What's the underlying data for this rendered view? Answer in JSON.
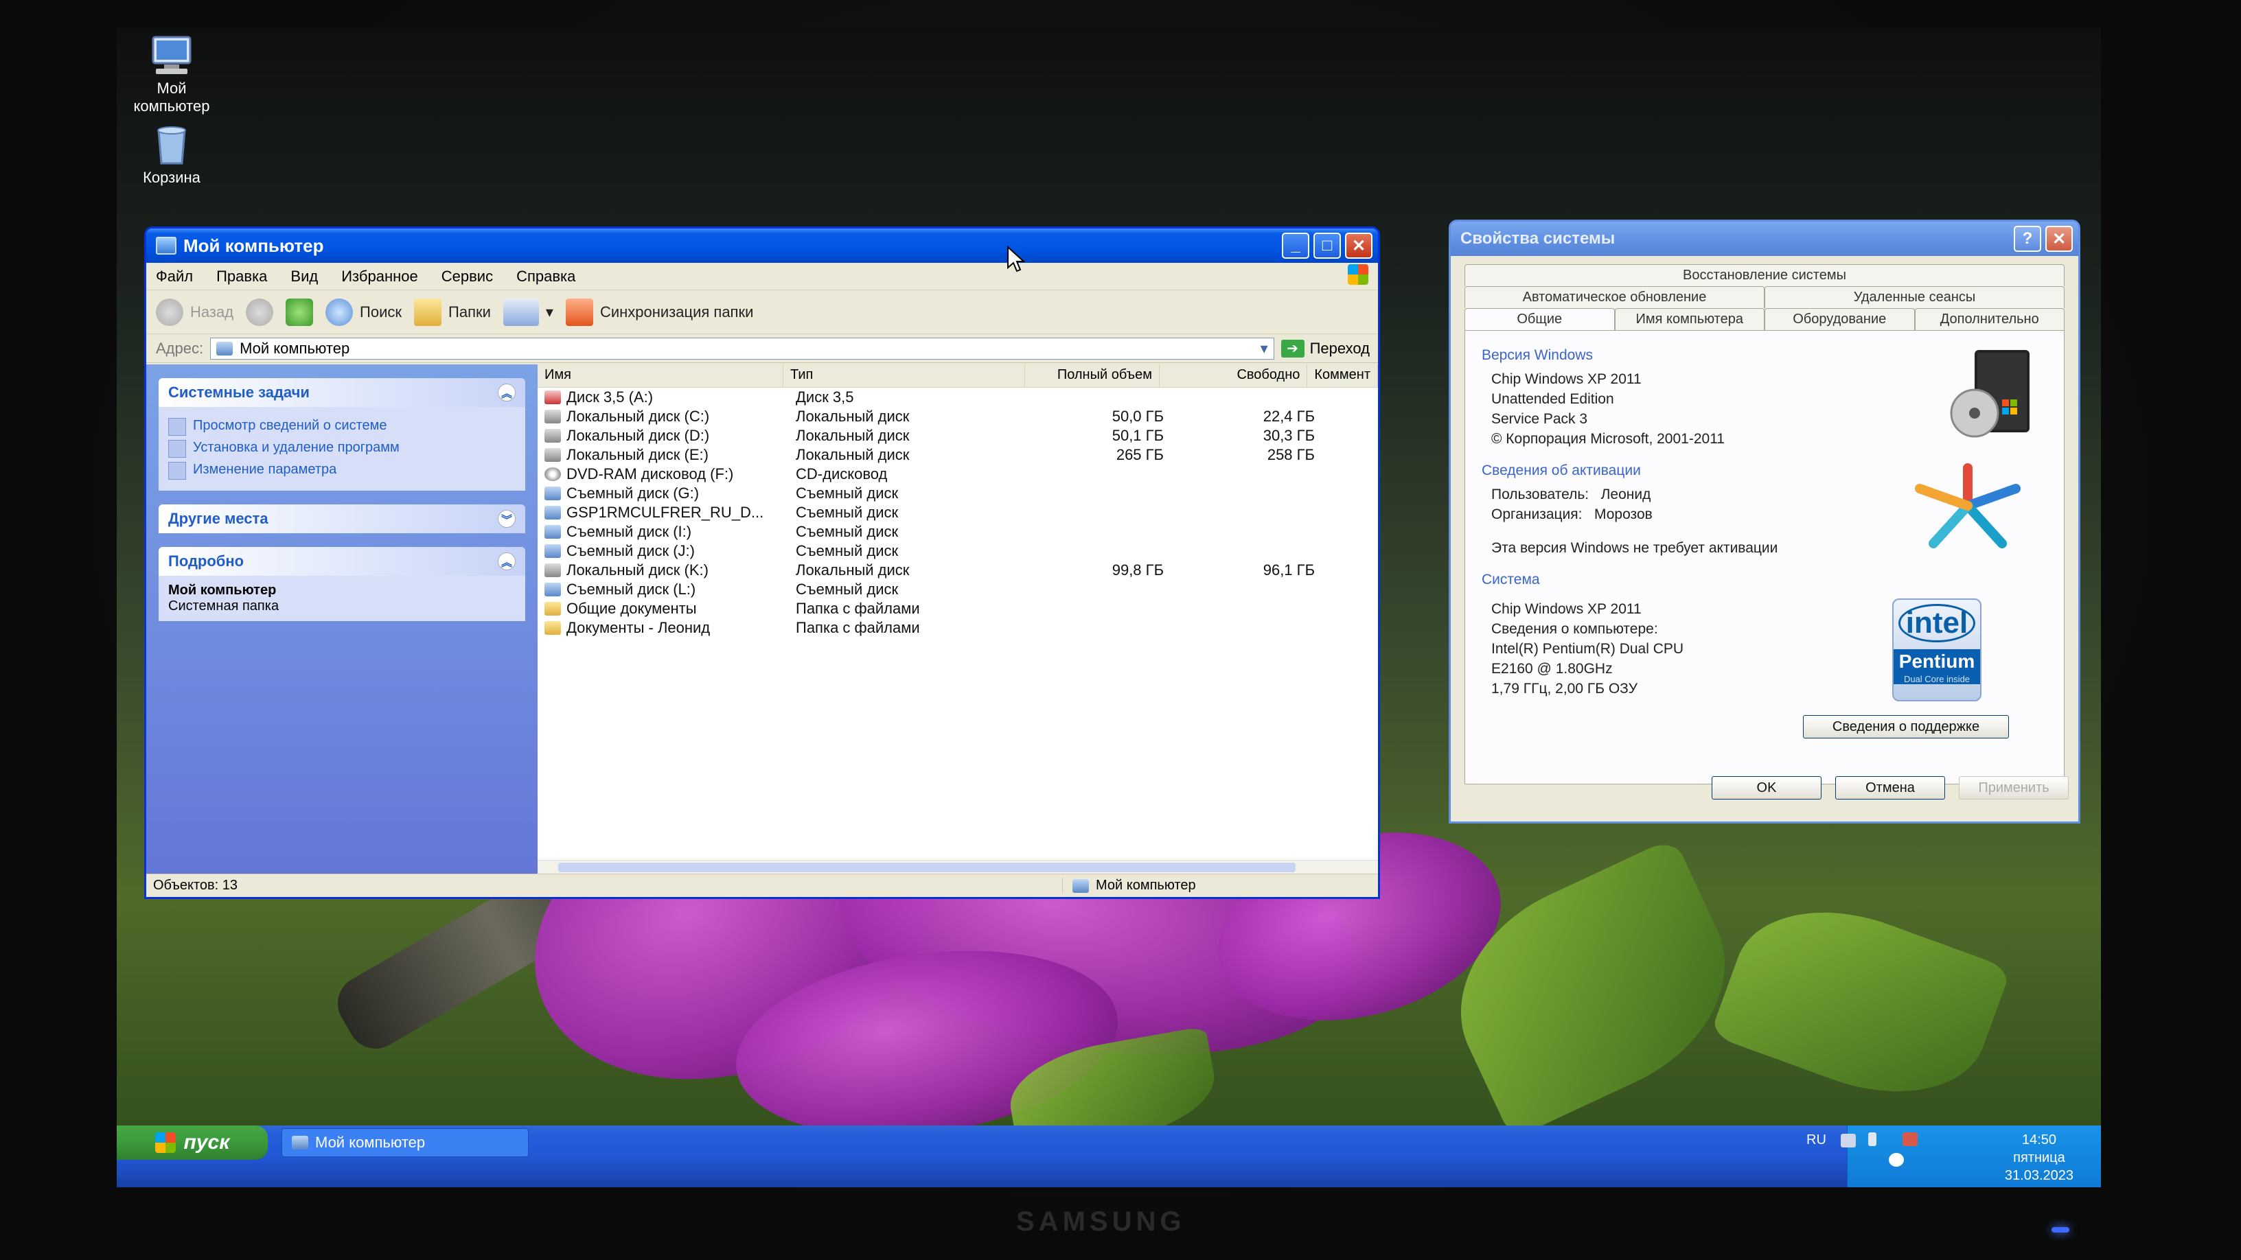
{
  "desktop": {
    "icons": [
      {
        "label_line1": "Мой",
        "label_line2": "компьютер",
        "icon": "my-computer-icon"
      },
      {
        "label_line1": "Корзина",
        "label_line2": "",
        "icon": "recycle-bin-icon"
      }
    ]
  },
  "explorer": {
    "title": "Мой компьютер",
    "menu": [
      "Файл",
      "Правка",
      "Вид",
      "Избранное",
      "Сервис",
      "Справка"
    ],
    "toolbar": {
      "back": "Назад",
      "search": "Поиск",
      "folders": "Папки",
      "sync": "Синхронизация папки"
    },
    "address": {
      "label": "Адрес:",
      "value": "Мой компьютер",
      "go": "Переход"
    },
    "side": {
      "system_tasks": {
        "title": "Системные задачи",
        "items": [
          "Просмотр сведений о системе",
          "Установка и удаление программ",
          "Изменение параметра"
        ]
      },
      "other_places": {
        "title": "Другие места"
      },
      "details": {
        "title": "Подробно",
        "name": "Мой компьютер",
        "desc": "Системная папка"
      }
    },
    "columns": [
      "Имя",
      "Тип",
      "Полный объем",
      "Свободно",
      "Коммент"
    ],
    "rows": [
      {
        "name": "Диск 3,5 (A:)",
        "type": "Диск 3,5",
        "total": "",
        "free": "",
        "icon": "fl"
      },
      {
        "name": "Локальный диск (C:)",
        "type": "Локальный диск",
        "total": "50,0 ГБ",
        "free": "22,4 ГБ",
        "icon": "hd"
      },
      {
        "name": "Локальный диск (D:)",
        "type": "Локальный диск",
        "total": "50,1 ГБ",
        "free": "30,3 ГБ",
        "icon": "hd"
      },
      {
        "name": "Локальный диск (E:)",
        "type": "Локальный диск",
        "total": "265 ГБ",
        "free": "258 ГБ",
        "icon": "hd"
      },
      {
        "name": "DVD-RAM дисковод (F:)",
        "type": "CD-дисковод",
        "total": "",
        "free": "",
        "icon": "cd"
      },
      {
        "name": "Съемный диск (G:)",
        "type": "Съемный диск",
        "total": "",
        "free": "",
        "icon": "rm"
      },
      {
        "name": "GSP1RMCULFRER_RU_D...",
        "type": "Съемный диск",
        "total": "",
        "free": "",
        "icon": "rm"
      },
      {
        "name": "Съемный диск (I:)",
        "type": "Съемный диск",
        "total": "",
        "free": "",
        "icon": "rm"
      },
      {
        "name": "Съемный диск (J:)",
        "type": "Съемный диск",
        "total": "",
        "free": "",
        "icon": "rm"
      },
      {
        "name": "Локальный диск (K:)",
        "type": "Локальный диск",
        "total": "99,8 ГБ",
        "free": "96,1 ГБ",
        "icon": "hd"
      },
      {
        "name": "Съемный диск (L:)",
        "type": "Съемный диск",
        "total": "",
        "free": "",
        "icon": "rm"
      },
      {
        "name": "Общие документы",
        "type": "Папка с файлами",
        "total": "",
        "free": "",
        "icon": "fo"
      },
      {
        "name": "Документы - Леонид",
        "type": "Папка с файлами",
        "total": "",
        "free": "",
        "icon": "fo"
      }
    ],
    "status": {
      "count": "Объектов: 13",
      "location": "Мой компьютер"
    }
  },
  "sysprops": {
    "title": "Свойства системы",
    "tabs_row1": [
      "Восстановление системы"
    ],
    "tabs_row2": [
      "Автоматическое обновление",
      "Удаленные сеансы"
    ],
    "tabs_row3": [
      "Общие",
      "Имя компьютера",
      "Оборудование",
      "Дополнительно"
    ],
    "windows_version": {
      "label": "Версия Windows",
      "lines": [
        "Chip Windows XP 2011",
        "Unattended Edition",
        "Service Pack 3",
        "© Корпорация Microsoft, 2001-2011"
      ]
    },
    "activation": {
      "label": "Сведения об активации",
      "user_label": "Пользователь:",
      "user": "Леонид",
      "org_label": "Организация:",
      "org": "Морозов",
      "note": "Эта версия Windows не требует активации"
    },
    "system": {
      "label": "Система",
      "lines": [
        "Chip Windows XP 2011",
        "Сведения о компьютере:",
        "Intel(R) Pentium(R) Dual CPU",
        "E2160 @ 1.80GHz",
        "1,79 ГГц, 2,00 ГБ ОЗУ"
      ],
      "logo_top": "intel",
      "logo_mid": "Pentium",
      "logo_bottom": "Dual Core inside",
      "support_button": "Сведения о поддержке"
    },
    "buttons": {
      "ok": "OK",
      "cancel": "Отмена",
      "apply": "Применить"
    }
  },
  "taskbar": {
    "start": "пуск",
    "task": "Мой компьютер",
    "lang": "RU",
    "time": "14:50",
    "day": "пятница",
    "date": "31.03.2023"
  },
  "monitor_brand": "SAMSUNG",
  "colors": {
    "xp_blue": "#0054e3",
    "start_green": "#3c9a3c",
    "tray_blue": "#0f7bd6"
  }
}
